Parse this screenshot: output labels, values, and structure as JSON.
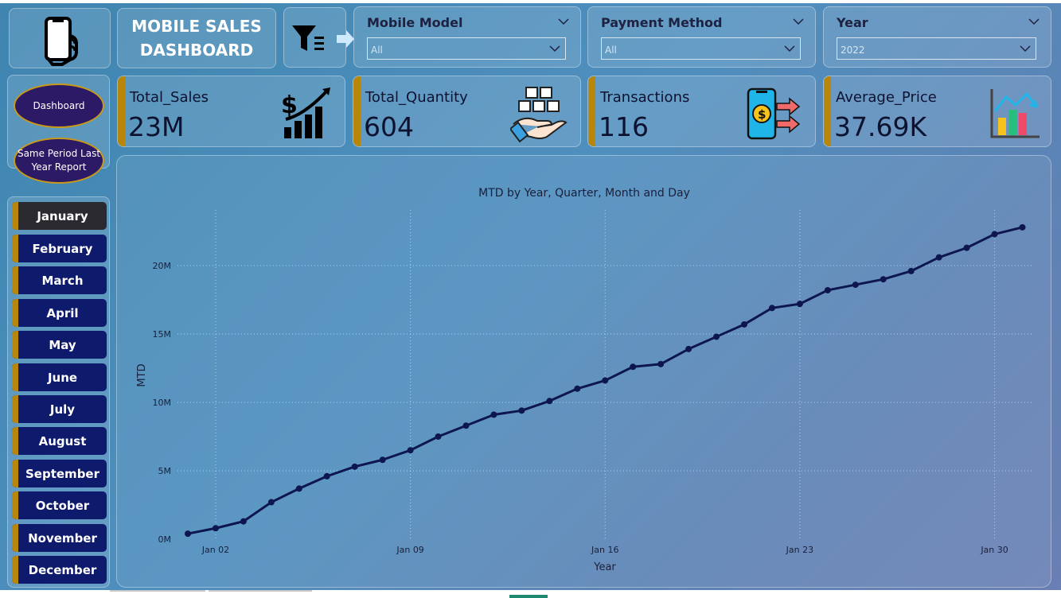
{
  "header": {
    "title_line1": "MOBILE SALES",
    "title_line2": "DASHBOARD",
    "icons": [
      "smartphone-hand-icon",
      "filter-icon",
      "arrow-right-icon"
    ]
  },
  "slicers": [
    {
      "label": "Mobile Model",
      "value": "All"
    },
    {
      "label": "Payment Method",
      "value": "All"
    },
    {
      "label": "Year",
      "value": "2022"
    }
  ],
  "kpis": [
    {
      "name": "Total_Sales",
      "value": "23M",
      "icon": "sales-growth-icon"
    },
    {
      "name": "Total_Quantity",
      "value": "604",
      "icon": "boxes-in-hand-icon"
    },
    {
      "name": "Transactions",
      "value": "116",
      "icon": "phone-payment-icon"
    },
    {
      "name": "Average_Price",
      "value": "37.69K",
      "icon": "bar-chart-icon"
    }
  ],
  "nav": {
    "dashboard": "Dashboard",
    "sply_line1": "Same Period Last",
    "sply_line2": "Year Report"
  },
  "months": [
    "January",
    "February",
    "March",
    "April",
    "May",
    "June",
    "July",
    "August",
    "September",
    "October",
    "November",
    "December"
  ],
  "selected_month": "January",
  "colors": {
    "accent_bar": "#b8860b",
    "month_button": "#0e1a6b",
    "selected_month": "#2b2a31",
    "line": "#0e1650",
    "pill": "#2d1a66"
  },
  "chart_data": {
    "type": "line",
    "title": "MTD by Year, Quarter, Month and Day",
    "xlabel": "Year",
    "ylabel": "MTD",
    "x_ticks": [
      "Jan 02",
      "Jan 09",
      "Jan 16",
      "Jan 23",
      "Jan 30"
    ],
    "y_ticks": [
      "0M",
      "5M",
      "10M",
      "15M",
      "20M"
    ],
    "ylim": [
      0,
      24
    ],
    "grid": true,
    "legend": "none",
    "x": [
      "Jan 01",
      "Jan 02",
      "Jan 03",
      "Jan 04",
      "Jan 05",
      "Jan 06",
      "Jan 07",
      "Jan 08",
      "Jan 09",
      "Jan 10",
      "Jan 11",
      "Jan 12",
      "Jan 13",
      "Jan 14",
      "Jan 15",
      "Jan 16",
      "Jan 17",
      "Jan 18",
      "Jan 19",
      "Jan 20",
      "Jan 21",
      "Jan 22",
      "Jan 23",
      "Jan 24",
      "Jan 25",
      "Jan 26",
      "Jan 27",
      "Jan 28",
      "Jan 29",
      "Jan 30",
      "Jan 31"
    ],
    "series": [
      {
        "values": [
          0.4,
          0.8,
          1.3,
          2.7,
          3.7,
          4.6,
          5.3,
          5.8,
          6.5,
          7.5,
          8.3,
          9.1,
          9.4,
          10.1,
          11.0,
          11.6,
          12.6,
          12.8,
          13.9,
          14.8,
          15.7,
          16.9,
          17.2,
          18.2,
          18.6,
          19.0,
          19.6,
          20.6,
          21.3,
          22.3,
          22.8
        ]
      }
    ]
  }
}
